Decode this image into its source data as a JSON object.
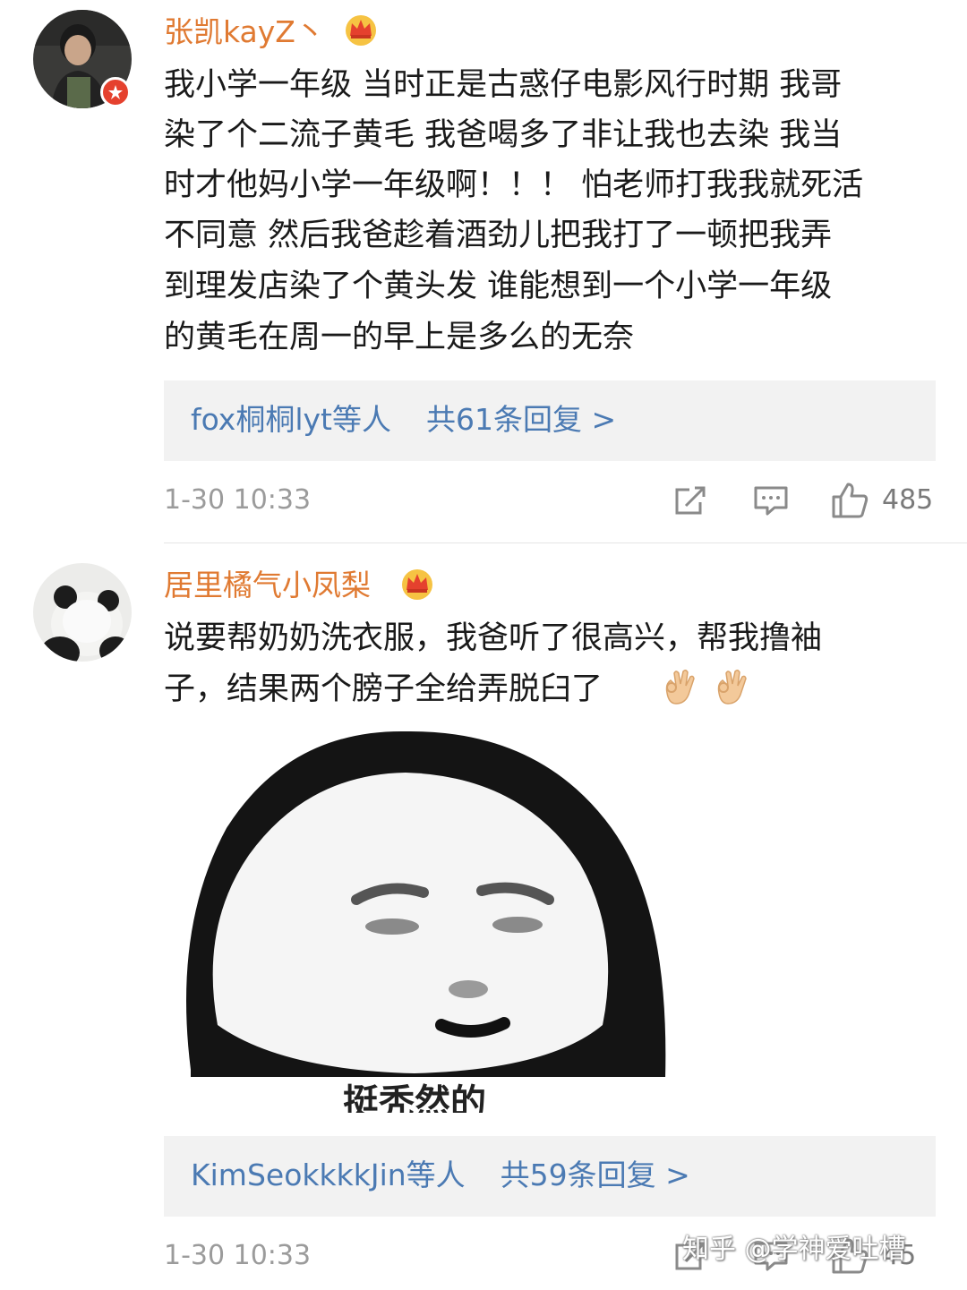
{
  "comments": [
    {
      "username": "张凯kayZ丶",
      "body_lines": [
        "我小学一年级 当时正是古惑仔电影风行时期 我哥",
        "染了个二流子黄毛 我爸喝多了非让我也去染 我当",
        "时才他妈小学一年级啊！！！ 怕老师打我我就死活",
        "不同意 然后我爸趁着酒劲儿把我打了一顿把我弄",
        "到理发店染了个黄头发 谁能想到一个小学一年级",
        "的黄毛在周一的早上是多么的无奈"
      ],
      "reply_users": "fox桐桐lyt等人",
      "reply_count": "共61条回复 >",
      "time": "1-30 10:33",
      "likes": "485"
    },
    {
      "username": "居里橘气小凤梨",
      "body_lines": [
        "说要帮奶奶洗衣服，我爸听了很高兴，帮我撸袖",
        "子，结果两个膀子全给弄脱臼了"
      ],
      "meme_caption": "挺秃然的",
      "reply_users": "KimSeokkkkJin等人",
      "reply_count": "共59条回复 >",
      "time": "1-30 10:33",
      "likes": "45"
    }
  ],
  "watermark": "知乎 @学神爱吐槽",
  "colors": {
    "username": "#e07a32",
    "reply_link": "#4b7ab3",
    "reply_bg": "#f2f2f2",
    "meta": "#9b9b9b"
  }
}
